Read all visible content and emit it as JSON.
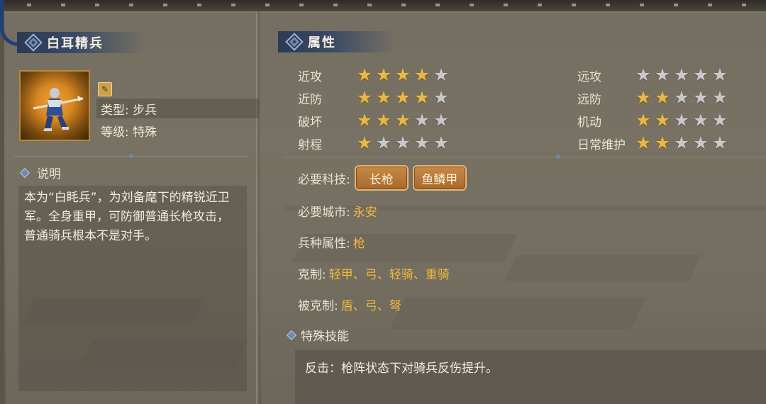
{
  "unit": {
    "name": "白耳精兵",
    "type_label": "类型: 步兵",
    "level_label": "等级: 特殊"
  },
  "description": {
    "heading": "说明",
    "text": "本为“白眊兵”，为刘备麾下的精锐近卫军。全身重甲，可防御普通长枪攻击，普通骑兵根本不是对手。"
  },
  "attributes": {
    "heading": "属性",
    "left": [
      {
        "label": "近攻",
        "stars": 4
      },
      {
        "label": "近防",
        "stars": 4
      },
      {
        "label": "破坏",
        "stars": 3
      },
      {
        "label": "射程",
        "stars": 1
      }
    ],
    "right": [
      {
        "label": "远攻",
        "stars": 0
      },
      {
        "label": "远防",
        "stars": 2
      },
      {
        "label": "机动",
        "stars": 2
      },
      {
        "label": "日常维护",
        "stars": 2
      }
    ],
    "max_stars": 5
  },
  "requirements": {
    "tech_label": "必要科技:",
    "techs": [
      "长枪",
      "鱼鳞甲"
    ],
    "city_label": "必要城市:",
    "city": "永安",
    "attr_label": "兵种属性:",
    "attr": "枪",
    "counters_label": "克制:",
    "counters": "轻甲、弓、轻骑、重骑",
    "countered_label": "被克制:",
    "countered": "盾、弓、弩"
  },
  "special_skill": {
    "heading": "特殊技能",
    "text": "反击：枪阵状态下对骑兵反伤提升。"
  },
  "colors": {
    "star_on": "#e6b84a",
    "star_off": "#c8c8c8",
    "accent_value": "#f2b83e",
    "title_bar": "#394a66"
  }
}
